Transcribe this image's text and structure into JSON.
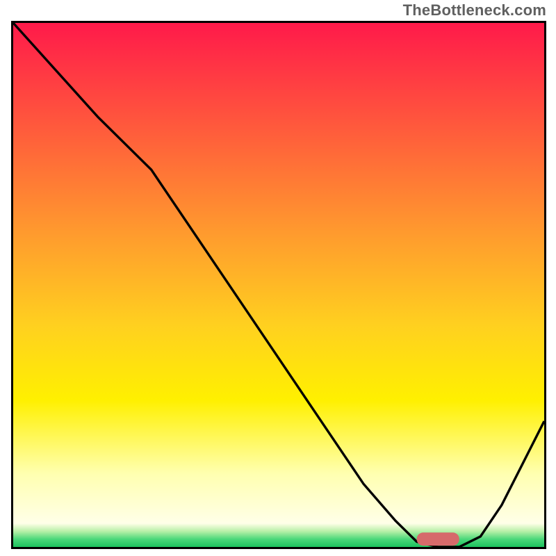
{
  "watermark": "TheBottleneck.com",
  "colors": {
    "frame": "#000000",
    "line": "#000000",
    "marker": "#d66a6b",
    "gradient_stops": [
      {
        "offset": 0.0,
        "color": "#ff1a4a"
      },
      {
        "offset": 0.2,
        "color": "#ff5a3c"
      },
      {
        "offset": 0.4,
        "color": "#ff9a2e"
      },
      {
        "offset": 0.58,
        "color": "#ffd11f"
      },
      {
        "offset": 0.72,
        "color": "#fff000"
      },
      {
        "offset": 0.86,
        "color": "#ffffb0"
      },
      {
        "offset": 0.955,
        "color": "#ffffe8"
      },
      {
        "offset": 0.97,
        "color": "#b8f0a8"
      },
      {
        "offset": 0.985,
        "color": "#4cd87a"
      },
      {
        "offset": 1.0,
        "color": "#1cc25e"
      }
    ]
  },
  "chart_data": {
    "type": "line",
    "title": "",
    "xlabel": "",
    "ylabel": "",
    "xlim": [
      0,
      100
    ],
    "ylim": [
      0,
      100
    ],
    "series": [
      {
        "name": "bottleneck-curve",
        "x": [
          0,
          8,
          16,
          24,
          26,
          34,
          42,
          50,
          58,
          66,
          72,
          76,
          80,
          84,
          88,
          92,
          96,
          100
        ],
        "y": [
          100,
          91,
          82,
          74,
          72,
          60,
          48,
          36,
          24,
          12,
          5,
          1,
          0,
          0,
          2,
          8,
          16,
          24
        ]
      }
    ],
    "marker": {
      "name": "optimal-range",
      "x_start": 76,
      "x_end": 84,
      "y": 1.5,
      "thickness": 2.5
    }
  }
}
